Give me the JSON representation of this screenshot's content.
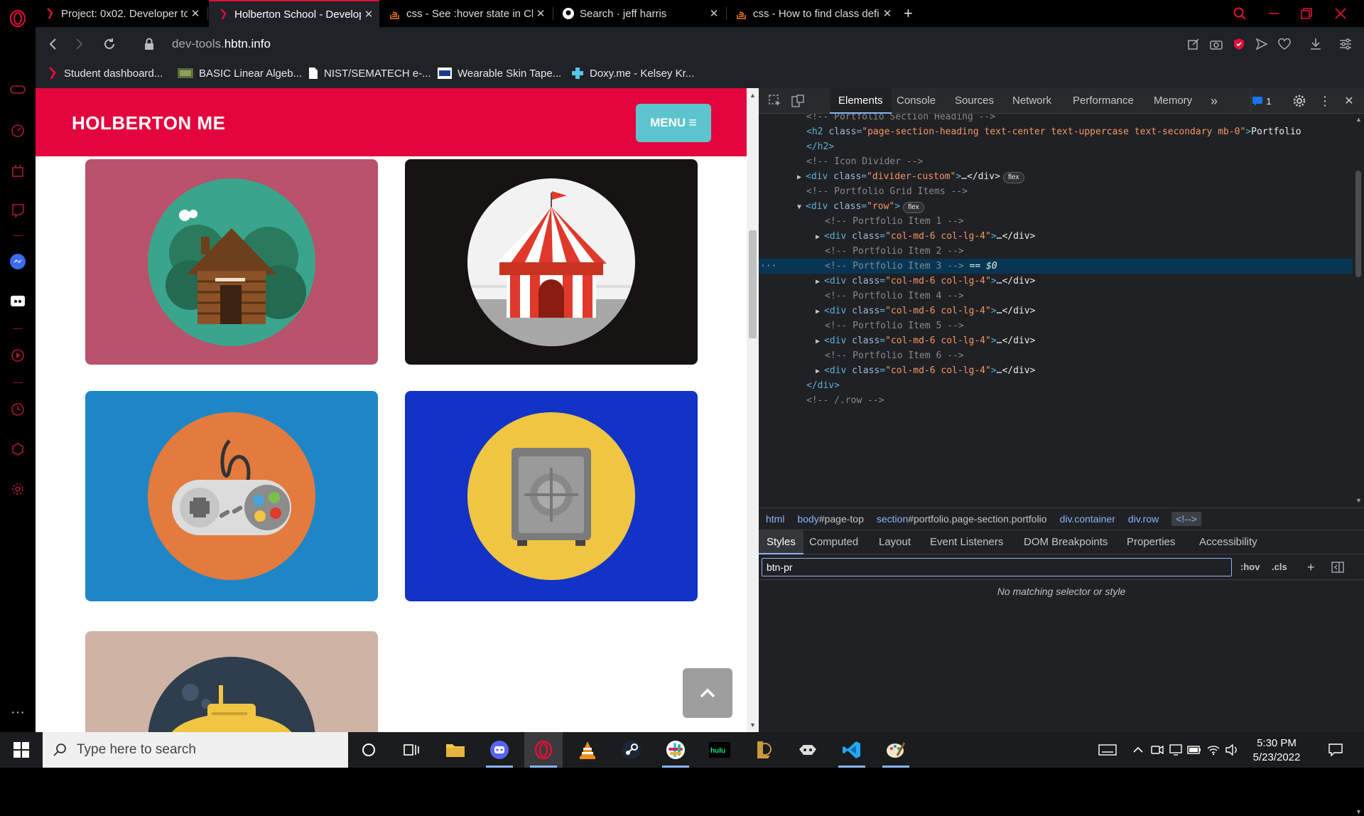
{
  "browser": {
    "tabs": [
      {
        "title": "Project: 0x02. Developer to",
        "active": false
      },
      {
        "title": "Holberton School - Develop",
        "active": true
      },
      {
        "title": "css - See :hover state in Ch",
        "active": false
      },
      {
        "title": "Search · jeff harris",
        "active": false
      },
      {
        "title": "css - How to find class defi",
        "active": false
      }
    ],
    "new_tab": "+",
    "close_glyph": "✕",
    "url": {
      "prefix": "dev-tools.",
      "domain": "hbtn.info"
    },
    "bookmarks": [
      {
        "label": "Student dashboard...",
        "icon": "holberton-icon"
      },
      {
        "label": "BASIC Linear Algeb...",
        "icon": "lapack-icon"
      },
      {
        "label": "NIST/SEMATECH e-...",
        "icon": "document-icon"
      },
      {
        "label": "Wearable Skin Tape...",
        "icon": "tape-icon"
      },
      {
        "label": "Doxy.me - Kelsey Kr...",
        "icon": "doxy-icon"
      }
    ]
  },
  "page": {
    "brand": "HOLBERTON ME",
    "menu_label": "MENU",
    "menu_glyph": "≡",
    "scroll_top_glyph": "⌃",
    "colors": {
      "navbar": "#e4053e",
      "menu": "#5bc4cd"
    },
    "cards": [
      {
        "name": "cabin",
        "bg": "#b9526b",
        "circle": "#3aa58c"
      },
      {
        "name": "circus",
        "bg": "#161313",
        "circle": "#f2f2f2"
      },
      {
        "name": "game",
        "bg": "#1e86c6",
        "circle": "#e37b3f"
      },
      {
        "name": "safe",
        "bg": "#1233c6",
        "circle": "#f0c542"
      },
      {
        "name": "submarine",
        "bg": "#cfb3a5",
        "circle": "#2e3e4d"
      }
    ]
  },
  "devtools": {
    "tabs": [
      "Elements",
      "Console",
      "Sources",
      "Network",
      "Performance",
      "Memory"
    ],
    "more": "»",
    "issues_count": "1",
    "close": "✕",
    "kebab": "⋮",
    "lines": [
      {
        "indent": 5,
        "kind": "comment",
        "text": "<!-- Portfolio Section Heading -->"
      },
      {
        "indent": 5,
        "kind": "h2",
        "attr": "class",
        "val": "\"page-section-heading text-center text-uppercase text-secondary mb-0\"",
        "content": "Portfolio"
      },
      {
        "indent": 5,
        "kind": "close",
        "text": "</h2>"
      },
      {
        "indent": 5,
        "kind": "comment",
        "text": "<!-- Icon Divider -->"
      },
      {
        "indent": 4,
        "kind": "div",
        "tri": "▶",
        "attr": "class",
        "val": "\"divider-custom\"",
        "tail": "…</div>",
        "badge": "flex"
      },
      {
        "indent": 5,
        "kind": "comment",
        "text": "<!-- Portfolio Grid Items -->"
      },
      {
        "indent": 4,
        "kind": "div",
        "tri": "▼",
        "attr": "class",
        "val": "\"row\"",
        "tail": "",
        "badge": "flex"
      },
      {
        "indent": 7,
        "kind": "comment",
        "text": "<!-- Portfolio Item 1 -->"
      },
      {
        "indent": 6,
        "kind": "div",
        "tri": "▶",
        "attr": "class",
        "val": "\"col-md-6 col-lg-4\"",
        "tail": "…</div>",
        "badge": ""
      },
      {
        "indent": 7,
        "kind": "comment",
        "text": "<!-- Portfolio Item 2 -->"
      },
      {
        "indent": 7,
        "kind": "comment",
        "text": "<!-- Portfolio Item 3 -->",
        "selected": true,
        "suffix": "== $0"
      },
      {
        "indent": 6,
        "kind": "div",
        "tri": "▶",
        "attr": "class",
        "val": "\"col-md-6 col-lg-4\"",
        "tail": "…</div>",
        "badge": ""
      },
      {
        "indent": 7,
        "kind": "comment",
        "text": "<!-- Portfolio Item 4 -->"
      },
      {
        "indent": 6,
        "kind": "div",
        "tri": "▶",
        "attr": "class",
        "val": "\"col-md-6 col-lg-4\"",
        "tail": "…</div>",
        "badge": ""
      },
      {
        "indent": 7,
        "kind": "comment",
        "text": "<!-- Portfolio Item 5 -->"
      },
      {
        "indent": 6,
        "kind": "div",
        "tri": "▶",
        "attr": "class",
        "val": "\"col-md-6 col-lg-4\"",
        "tail": "…</div>",
        "badge": ""
      },
      {
        "indent": 7,
        "kind": "comment",
        "text": "<!-- Portfolio Item 6 -->"
      },
      {
        "indent": 6,
        "kind": "div",
        "tri": "▶",
        "attr": "class",
        "val": "\"col-md-6 col-lg-4\"",
        "tail": "…</div>",
        "badge": ""
      },
      {
        "indent": 5,
        "kind": "close",
        "text": "</div>"
      },
      {
        "indent": 5,
        "kind": "comment",
        "text": "<!-- /.row -->"
      }
    ],
    "breadcrumb": [
      {
        "tag": "html",
        "rest": ""
      },
      {
        "tag": "body",
        "rest": "#page-top"
      },
      {
        "tag": "section",
        "rest": "#portfolio.page-section.portfolio"
      },
      {
        "tag": "div",
        "rest": ".container"
      },
      {
        "tag": "div",
        "rest": ".row"
      },
      {
        "tag": "<!-->",
        "rest": ""
      }
    ],
    "styles_tabs": [
      "Styles",
      "Computed",
      "Layout",
      "Event Listeners",
      "DOM Breakpoints",
      "Properties",
      "Accessibility"
    ],
    "filter_value": "btn-pr",
    "hov": ":hov",
    "cls": ".cls",
    "plus": "+",
    "no_match": "No matching selector or style"
  },
  "taskbar": {
    "search_placeholder": "Type here to search",
    "time": "5:30 PM",
    "date": "5/23/2022"
  }
}
